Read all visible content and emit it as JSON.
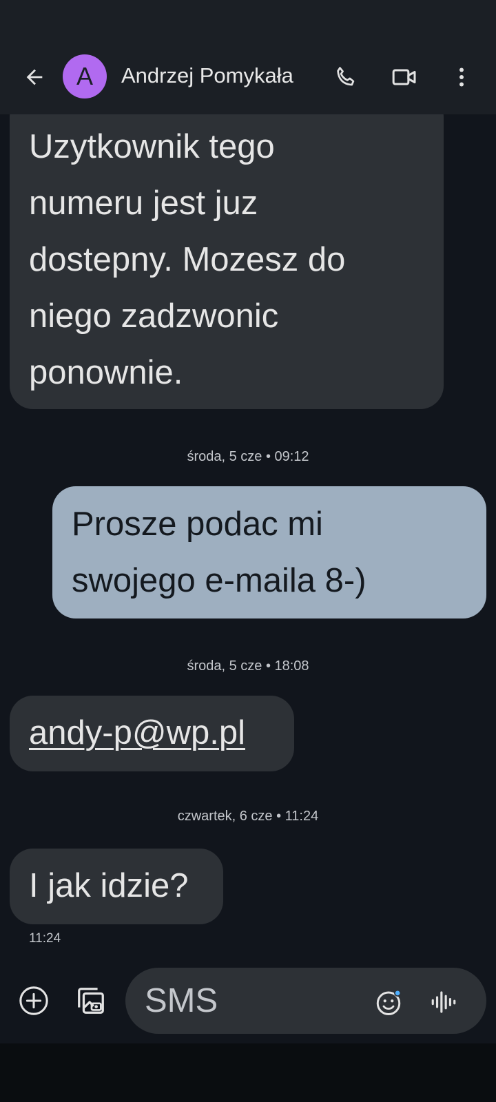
{
  "header": {
    "avatar_letter": "A",
    "contact_name": "Andrzej Pomykała",
    "icons": [
      "back-arrow-icon",
      "phone-icon",
      "video-call-icon",
      "more-vert-icon"
    ]
  },
  "messages": [
    {
      "type": "incoming",
      "lines": [
        "Uzytkownik tego",
        "numeru jest juz",
        "dostepny. Mozesz do",
        "niego zadzwonic",
        "ponownie."
      ]
    },
    {
      "type": "stamp",
      "text": "środa, 5 cze • 09:12"
    },
    {
      "type": "outgoing",
      "lines": [
        "Prosze podac mi",
        "swojego e-maila 8-)"
      ]
    },
    {
      "type": "stamp",
      "text": "środa, 5 cze • 18:08"
    },
    {
      "type": "incoming",
      "text": "andy-p@wp.pl"
    },
    {
      "type": "stamp",
      "text": "czwartek, 6 cze • 11:24"
    },
    {
      "type": "incoming",
      "text": "I jak idzie?"
    },
    {
      "type": "time",
      "text": "11:24"
    }
  ],
  "compose": {
    "placeholder": "SMS",
    "icons": [
      "add-circle-icon",
      "gallery-icon",
      "emoji-icon",
      "voice-wave-icon"
    ]
  },
  "colors": {
    "background": "#11151c",
    "app_bar": "#1b1f25",
    "incoming_bubble": "#2d3136",
    "outgoing_bubble": "#9eafc0",
    "avatar": "#b16af0",
    "emoji_dot": "#4fb0ff"
  }
}
